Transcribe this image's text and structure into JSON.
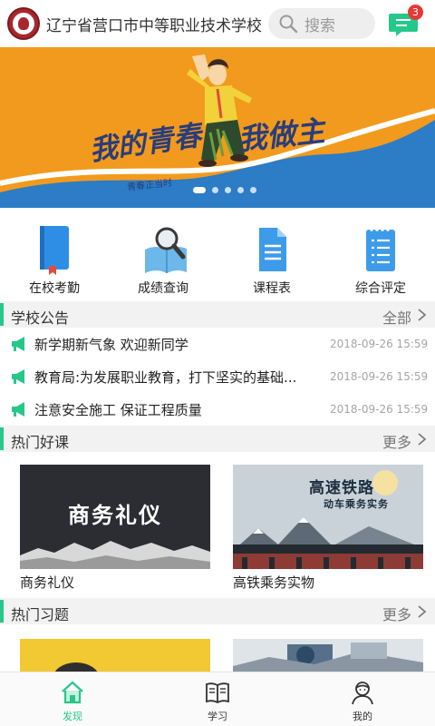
{
  "header": {
    "school_name": "辽宁省营口市中等职业技术学校",
    "search_placeholder": "搜索",
    "message_count": "3"
  },
  "banner": {
    "slogan_left": "我的青春",
    "slogan_right": "我做主",
    "subtitle": "青春正当时",
    "page_count": 5,
    "active_page": 1
  },
  "quick_menu": [
    {
      "label": "在校考勤",
      "icon": "notebook-icon"
    },
    {
      "label": "成绩查询",
      "icon": "magnifier-book-icon"
    },
    {
      "label": "课程表",
      "icon": "document-icon"
    },
    {
      "label": "综合评定",
      "icon": "checklist-icon"
    }
  ],
  "announcements": {
    "title": "学校公告",
    "more": "全部",
    "items": [
      {
        "title": "新学期新气象 欢迎新同学",
        "time": "2018-09-26 15:59"
      },
      {
        "title": "教育局:为发展职业教育，打下坚实的基础...",
        "time": "2018-09-26 15:59"
      },
      {
        "title": "注意安全施工  保证工程质量",
        "time": "2018-09-26 15:59"
      }
    ]
  },
  "courses": {
    "title": "热门好课",
    "more": "更多",
    "items": [
      {
        "title": "商务礼仪",
        "cover_text": "商务礼仪"
      },
      {
        "title": "高铁乘务实物",
        "cover_text": "高速铁路",
        "cover_sub": "动车乘务实务"
      }
    ]
  },
  "exercises": {
    "title": "热门习题",
    "more": "更多"
  },
  "tabs": [
    {
      "label": "发现",
      "icon": "home-icon",
      "active": true
    },
    {
      "label": "学习",
      "icon": "book-icon",
      "active": false
    },
    {
      "label": "我的",
      "icon": "person-icon",
      "active": false
    }
  ],
  "colors": {
    "accent": "#26c88a",
    "banner_orange": "#f29a1e",
    "banner_blue": "#2c7cc6",
    "badge": "#e53935"
  }
}
